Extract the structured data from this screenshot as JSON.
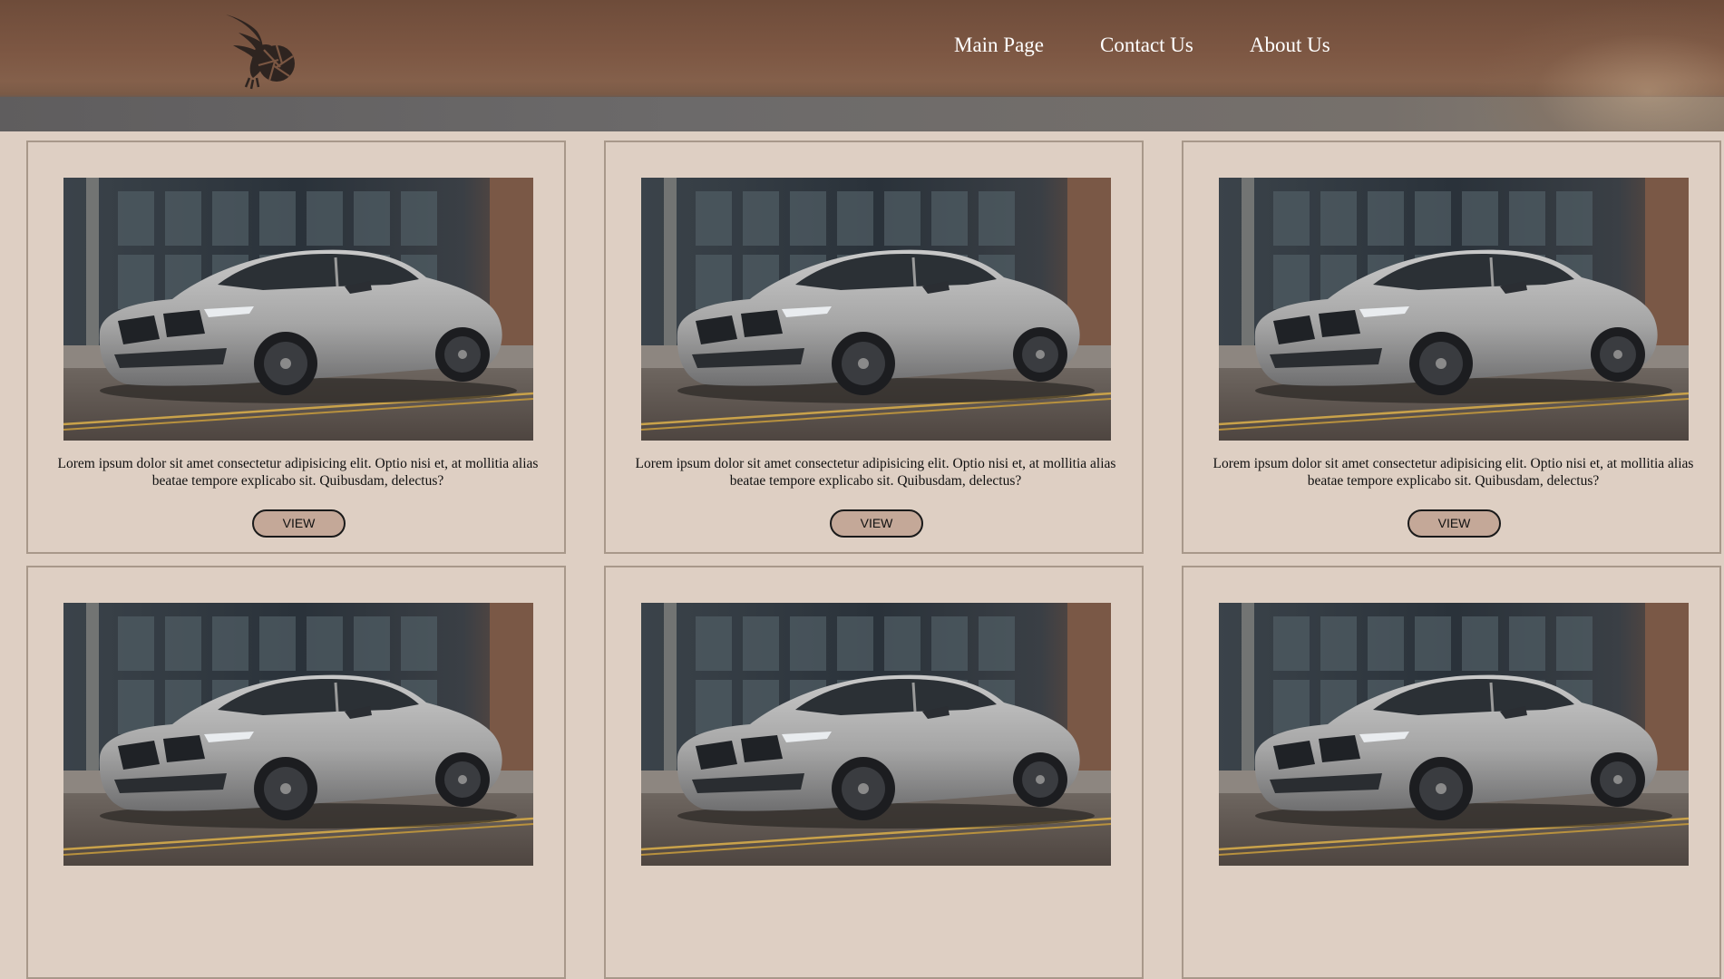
{
  "nav": {
    "items": [
      {
        "label": "Main Page"
      },
      {
        "label": "Contact Us"
      },
      {
        "label": "About Us"
      }
    ]
  },
  "cards": [
    {
      "description": "Lorem ipsum dolor sit amet consectetur adipisicing elit. Optio nisi et, at mollitia alias beatae tempore explicabo sit. Quibusdam, delectus?",
      "button_label": "VIEW"
    },
    {
      "description": "Lorem ipsum dolor sit amet consectetur adipisicing elit. Optio nisi et, at mollitia alias beatae tempore explicabo sit. Quibusdam, delectus?",
      "button_label": "VIEW"
    },
    {
      "description": "Lorem ipsum dolor sit amet consectetur adipisicing elit. Optio nisi et, at mollitia alias beatae tempore explicabo sit. Quibusdam, delectus?",
      "button_label": "VIEW"
    },
    {
      "description": "",
      "button_label": ""
    },
    {
      "description": "",
      "button_label": ""
    },
    {
      "description": "",
      "button_label": ""
    }
  ],
  "colors": {
    "page_background": "#decfc3",
    "card_border": "#a8988a",
    "button_fill": "#c4a898",
    "nav_text": "#ffffff"
  }
}
